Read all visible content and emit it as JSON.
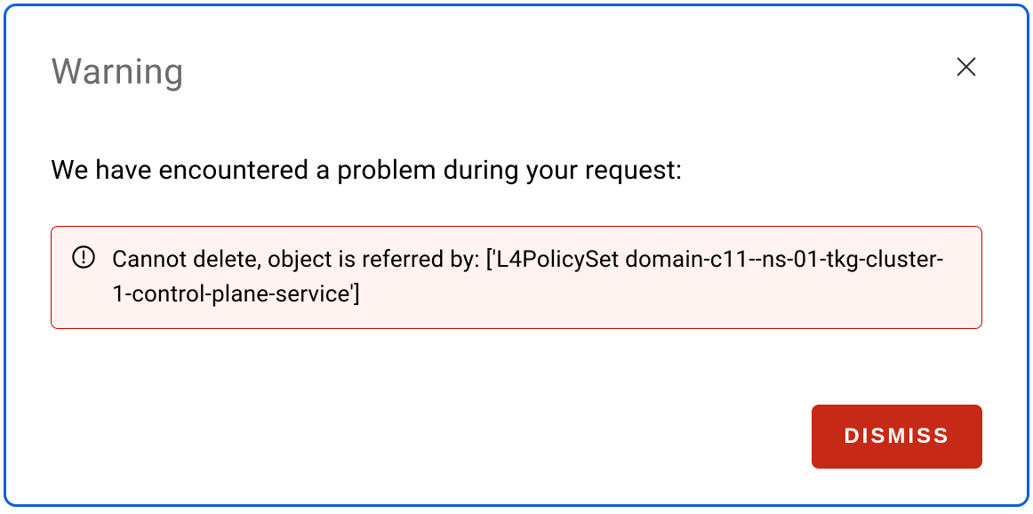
{
  "dialog": {
    "title": "Warning",
    "message": "We have encountered a problem during your request:",
    "error_text": "Cannot delete, object is referred by: ['L4PolicySet domain-c11--ns-01-tkg-cluster-1-control-plane-service']",
    "dismiss_label": "DISMISS"
  }
}
